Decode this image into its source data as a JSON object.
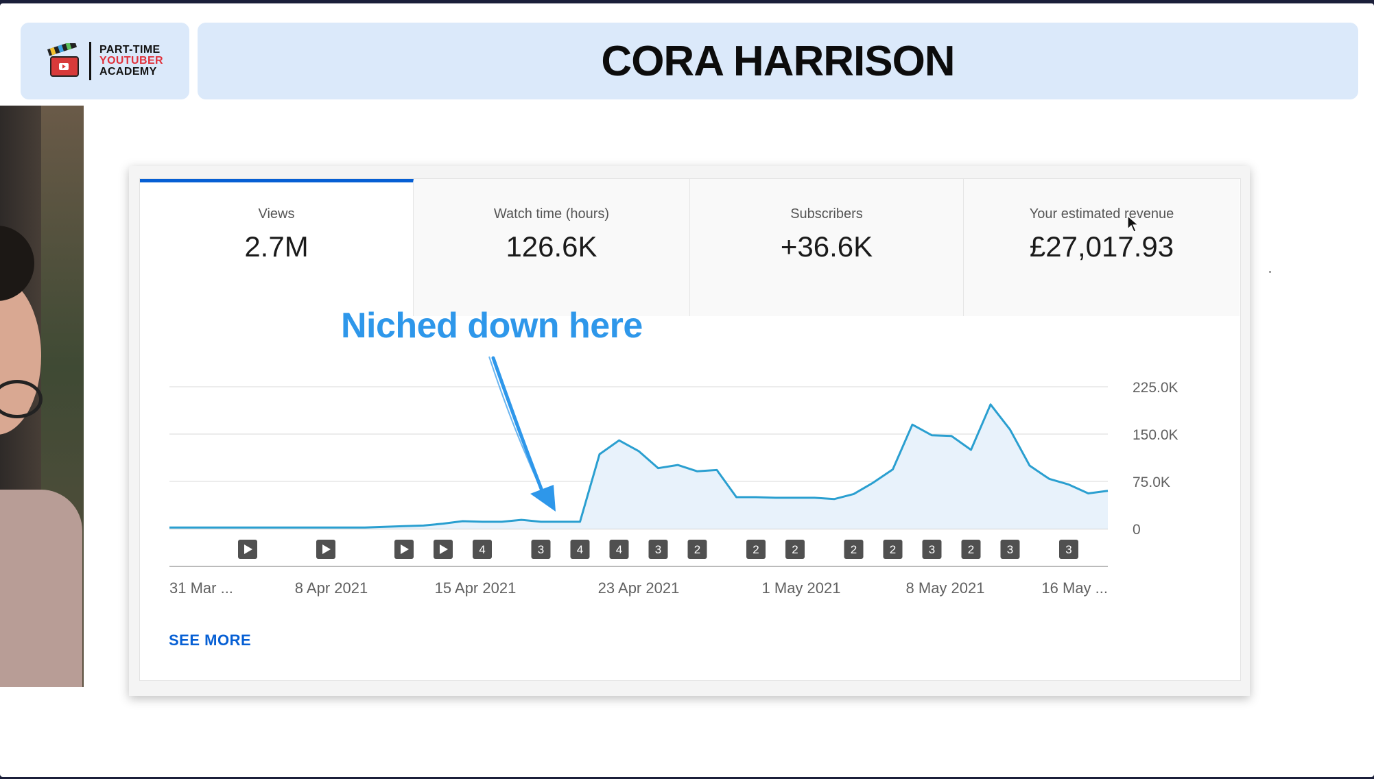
{
  "header": {
    "logo_lines": [
      "PART-TIME",
      "YOUTUBER",
      "ACADEMY"
    ],
    "title": "CORA HARRISON"
  },
  "tabs": [
    {
      "label": "Views",
      "value": "2.7M",
      "active": true
    },
    {
      "label": "Watch time (hours)",
      "value": "126.6K",
      "active": false
    },
    {
      "label": "Subscribers",
      "value": "+36.6K",
      "active": false
    },
    {
      "label": "Your estimated revenue",
      "value": "£27,017.93",
      "active": false
    }
  ],
  "annotation": {
    "text": "Niched down here",
    "color": "#2e97ea"
  },
  "see_more_label": "SEE MORE",
  "colors": {
    "accent": "#065fd4",
    "line": "#2a9fd0",
    "area": "#e8f2fb",
    "header_bg": "#dbe9fa"
  },
  "chart_data": {
    "type": "area",
    "x_tick_labels": [
      "31 Mar ...",
      "8 Apr 2021",
      "15 Apr 2021",
      "23 Apr 2021",
      "1 May 2021",
      "8 May 2021",
      "16 May ..."
    ],
    "y_tick_labels": [
      "225.0K",
      "150.0K",
      "75.0K",
      "0"
    ],
    "ylim": [
      0,
      225000
    ],
    "grid": true,
    "y_axis_side": "right",
    "values": [
      2000,
      2000,
      2000,
      2000,
      2000,
      2000,
      2000,
      2000,
      2000,
      2000,
      2000,
      3000,
      4000,
      5000,
      8000,
      12000,
      11000,
      11000,
      14000,
      11000,
      11000,
      11000,
      118000,
      140000,
      123000,
      96000,
      101000,
      91000,
      93000,
      50000,
      50000,
      49000,
      49000,
      49000,
      47000,
      55000,
      73000,
      94000,
      165000,
      148000,
      147000,
      125000,
      197000,
      157000,
      100000,
      79000,
      70000,
      56000,
      60000
    ],
    "markers": [
      {
        "index": 4,
        "label": "play"
      },
      {
        "index": 8,
        "label": "play"
      },
      {
        "index": 12,
        "label": "play"
      },
      {
        "index": 14,
        "label": "play"
      },
      {
        "index": 16,
        "label": "4"
      },
      {
        "index": 19,
        "label": "3"
      },
      {
        "index": 21,
        "label": "4"
      },
      {
        "index": 23,
        "label": "4"
      },
      {
        "index": 25,
        "label": "3"
      },
      {
        "index": 27,
        "label": "2"
      },
      {
        "index": 30,
        "label": "2"
      },
      {
        "index": 32,
        "label": "2"
      },
      {
        "index": 35,
        "label": "2"
      },
      {
        "index": 37,
        "label": "2"
      },
      {
        "index": 39,
        "label": "3"
      },
      {
        "index": 41,
        "label": "2"
      },
      {
        "index": 43,
        "label": "3"
      },
      {
        "index": 46,
        "label": "3"
      }
    ]
  }
}
